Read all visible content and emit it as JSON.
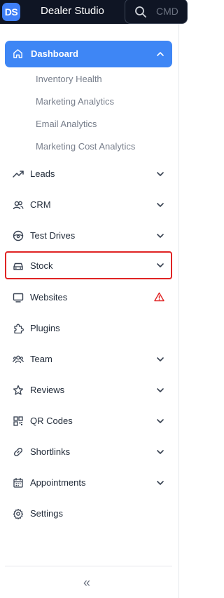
{
  "app": {
    "logo": "DS",
    "title": "Dealer Studio"
  },
  "search": {
    "placeholder": "CMD"
  },
  "nav": {
    "dashboard": {
      "label": "Dashboard",
      "subitems": [
        "Inventory Health",
        "Marketing Analytics",
        "Email Analytics",
        "Marketing Cost Analytics"
      ]
    },
    "items": [
      {
        "label": "Leads",
        "icon": "trending-up-icon",
        "chevron": true
      },
      {
        "label": "CRM",
        "icon": "users-icon",
        "chevron": true
      },
      {
        "label": "Test Drives",
        "icon": "steering-wheel-icon",
        "chevron": true
      },
      {
        "label": "Stock",
        "icon": "car-icon",
        "chevron": true,
        "highlighted": true
      },
      {
        "label": "Websites",
        "icon": "monitor-icon",
        "warning": true
      },
      {
        "label": "Plugins",
        "icon": "puzzle-icon"
      },
      {
        "label": "Team",
        "icon": "team-icon",
        "chevron": true
      },
      {
        "label": "Reviews",
        "icon": "star-icon",
        "chevron": true
      },
      {
        "label": "QR Codes",
        "icon": "qr-code-icon",
        "chevron": true
      },
      {
        "label": "Shortlinks",
        "icon": "link-icon",
        "chevron": true
      },
      {
        "label": "Appointments",
        "icon": "calendar-icon",
        "chevron": true
      },
      {
        "label": "Settings",
        "icon": "gear-icon"
      }
    ]
  },
  "footer": {
    "collapse": "«"
  },
  "colors": {
    "accent": "#3e86f5",
    "topbar": "#0f1524",
    "highlight": "#e02424",
    "warning": "#e02424"
  }
}
